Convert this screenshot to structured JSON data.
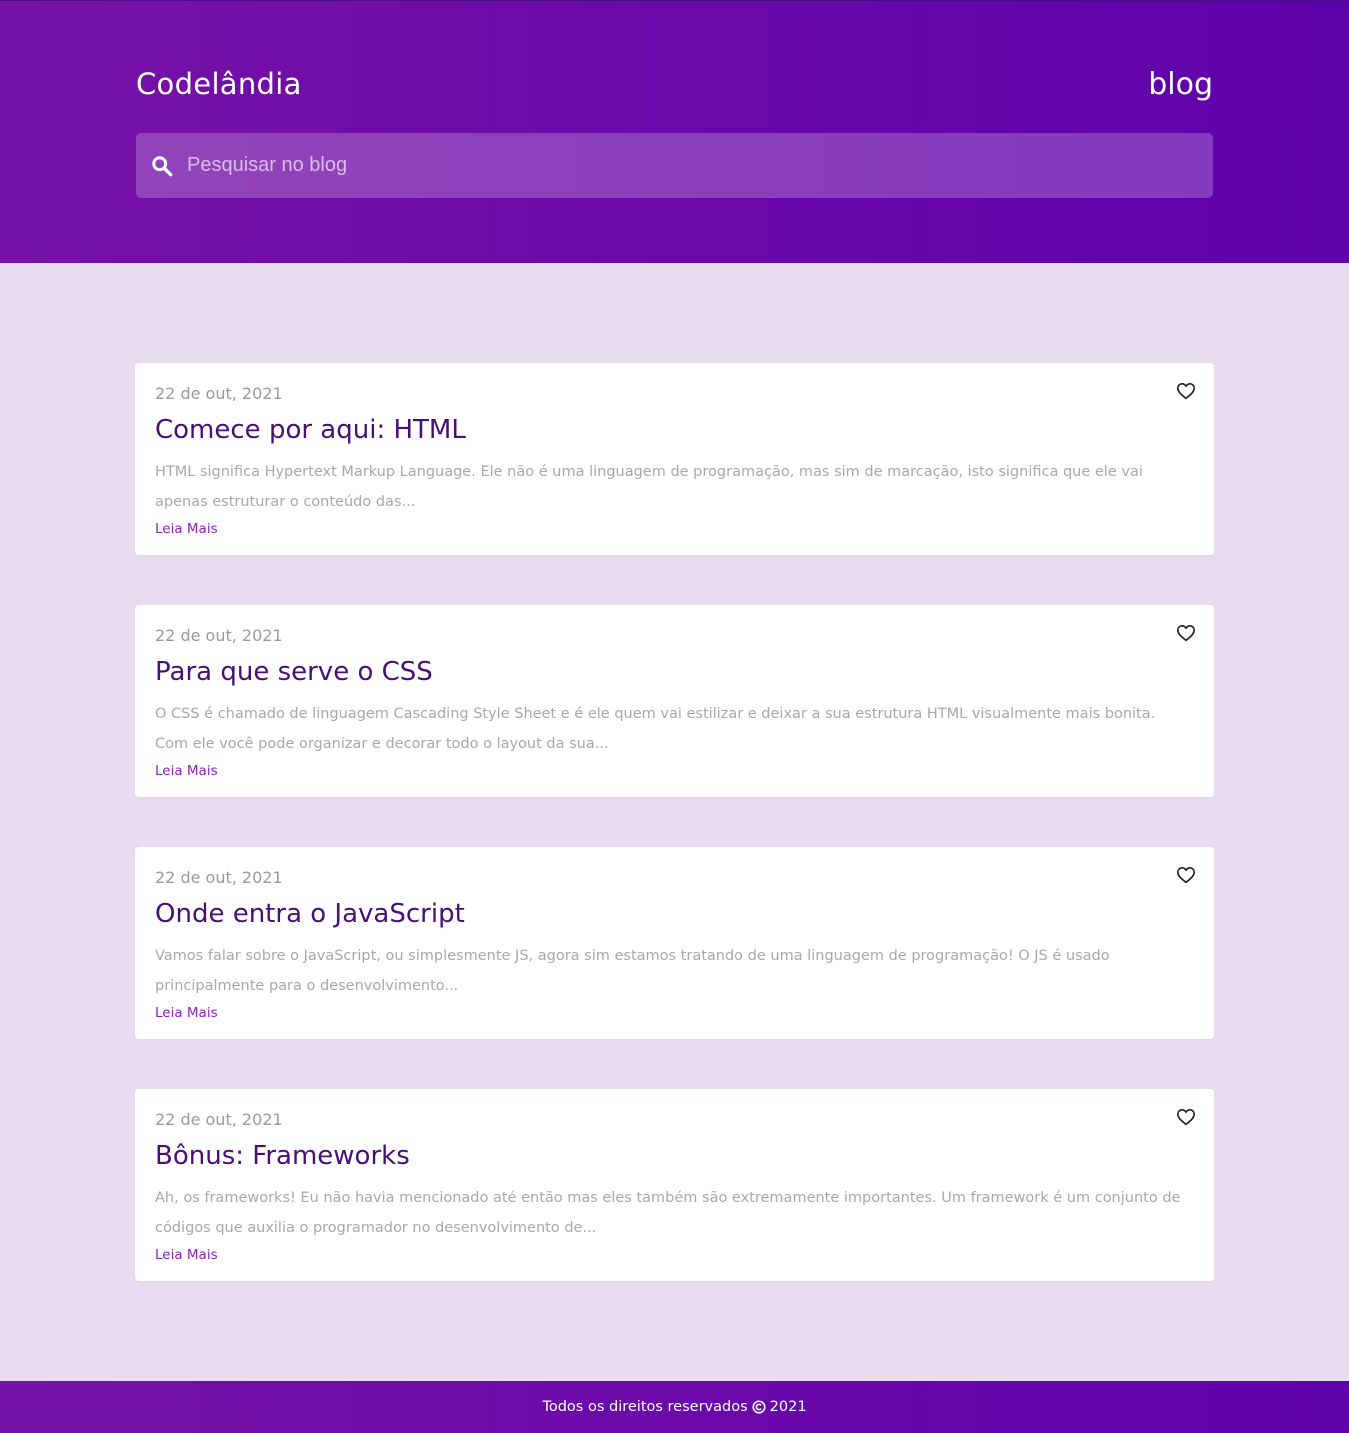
{
  "header": {
    "brand": "Codelândia",
    "nav_blog": "blog",
    "search_placeholder": "Pesquisar no blog",
    "search_icon": "search-icon"
  },
  "posts": [
    {
      "date": "22 de out, 2021",
      "title": "Comece por aqui: HTML",
      "excerpt": "HTML significa Hypertext Markup Language. Ele não é uma linguagem de programação, mas sim de marcação, isto significa que ele vai apenas estruturar o conteúdo das...",
      "link": "Leia Mais",
      "icon": "heart-icon"
    },
    {
      "date": "22 de out, 2021",
      "title": "Para que serve o CSS",
      "excerpt": "O CSS é chamado de linguagem Cascading Style Sheet e é ele quem vai estilizar e deixar a sua estrutura HTML visualmente mais bonita. Com ele você pode organizar e decorar todo o layout da sua...",
      "link": "Leia Mais",
      "icon": "heart-icon"
    },
    {
      "date": "22 de out, 2021",
      "title": "Onde entra o JavaScript",
      "excerpt": "Vamos falar sobre o JavaScript, ou simplesmente JS, agora sim estamos tratando de uma linguagem de programação! O JS é usado principalmente para o desenvolvimento...",
      "link": "Leia Mais",
      "icon": "heart-icon"
    },
    {
      "date": "22 de out, 2021",
      "title": "Bônus: Frameworks",
      "excerpt": "Ah, os frameworks! Eu não havia mencionado até então mas eles também são extremamente importantes. Um framework é um conjunto de códigos que auxilia o programador no desenvolvimento de...",
      "link": "Leia Mais",
      "icon": "heart-icon"
    }
  ],
  "footer": {
    "text_before": "Todos os direitos reservados",
    "year": "2021",
    "icon": "copyright-icon"
  },
  "colors": {
    "header_gradient_start": "#7612a6",
    "header_gradient_end": "#5e02ac",
    "page_background": "#e8dcf0",
    "title_color": "#4a0f73",
    "link_color": "#8a22b8"
  }
}
